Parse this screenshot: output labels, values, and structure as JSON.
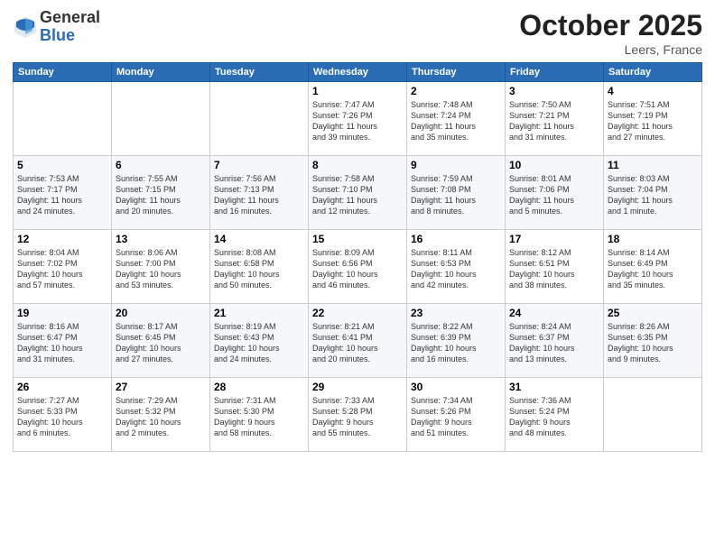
{
  "logo": {
    "general": "General",
    "blue": "Blue"
  },
  "header": {
    "month": "October 2025",
    "location": "Leers, France"
  },
  "weekdays": [
    "Sunday",
    "Monday",
    "Tuesday",
    "Wednesday",
    "Thursday",
    "Friday",
    "Saturday"
  ],
  "weeks": [
    [
      {
        "day": "",
        "info": ""
      },
      {
        "day": "",
        "info": ""
      },
      {
        "day": "",
        "info": ""
      },
      {
        "day": "1",
        "info": "Sunrise: 7:47 AM\nSunset: 7:26 PM\nDaylight: 11 hours\nand 39 minutes."
      },
      {
        "day": "2",
        "info": "Sunrise: 7:48 AM\nSunset: 7:24 PM\nDaylight: 11 hours\nand 35 minutes."
      },
      {
        "day": "3",
        "info": "Sunrise: 7:50 AM\nSunset: 7:21 PM\nDaylight: 11 hours\nand 31 minutes."
      },
      {
        "day": "4",
        "info": "Sunrise: 7:51 AM\nSunset: 7:19 PM\nDaylight: 11 hours\nand 27 minutes."
      }
    ],
    [
      {
        "day": "5",
        "info": "Sunrise: 7:53 AM\nSunset: 7:17 PM\nDaylight: 11 hours\nand 24 minutes."
      },
      {
        "day": "6",
        "info": "Sunrise: 7:55 AM\nSunset: 7:15 PM\nDaylight: 11 hours\nand 20 minutes."
      },
      {
        "day": "7",
        "info": "Sunrise: 7:56 AM\nSunset: 7:13 PM\nDaylight: 11 hours\nand 16 minutes."
      },
      {
        "day": "8",
        "info": "Sunrise: 7:58 AM\nSunset: 7:10 PM\nDaylight: 11 hours\nand 12 minutes."
      },
      {
        "day": "9",
        "info": "Sunrise: 7:59 AM\nSunset: 7:08 PM\nDaylight: 11 hours\nand 8 minutes."
      },
      {
        "day": "10",
        "info": "Sunrise: 8:01 AM\nSunset: 7:06 PM\nDaylight: 11 hours\nand 5 minutes."
      },
      {
        "day": "11",
        "info": "Sunrise: 8:03 AM\nSunset: 7:04 PM\nDaylight: 11 hours\nand 1 minute."
      }
    ],
    [
      {
        "day": "12",
        "info": "Sunrise: 8:04 AM\nSunset: 7:02 PM\nDaylight: 10 hours\nand 57 minutes."
      },
      {
        "day": "13",
        "info": "Sunrise: 8:06 AM\nSunset: 7:00 PM\nDaylight: 10 hours\nand 53 minutes."
      },
      {
        "day": "14",
        "info": "Sunrise: 8:08 AM\nSunset: 6:58 PM\nDaylight: 10 hours\nand 50 minutes."
      },
      {
        "day": "15",
        "info": "Sunrise: 8:09 AM\nSunset: 6:56 PM\nDaylight: 10 hours\nand 46 minutes."
      },
      {
        "day": "16",
        "info": "Sunrise: 8:11 AM\nSunset: 6:53 PM\nDaylight: 10 hours\nand 42 minutes."
      },
      {
        "day": "17",
        "info": "Sunrise: 8:12 AM\nSunset: 6:51 PM\nDaylight: 10 hours\nand 38 minutes."
      },
      {
        "day": "18",
        "info": "Sunrise: 8:14 AM\nSunset: 6:49 PM\nDaylight: 10 hours\nand 35 minutes."
      }
    ],
    [
      {
        "day": "19",
        "info": "Sunrise: 8:16 AM\nSunset: 6:47 PM\nDaylight: 10 hours\nand 31 minutes."
      },
      {
        "day": "20",
        "info": "Sunrise: 8:17 AM\nSunset: 6:45 PM\nDaylight: 10 hours\nand 27 minutes."
      },
      {
        "day": "21",
        "info": "Sunrise: 8:19 AM\nSunset: 6:43 PM\nDaylight: 10 hours\nand 24 minutes."
      },
      {
        "day": "22",
        "info": "Sunrise: 8:21 AM\nSunset: 6:41 PM\nDaylight: 10 hours\nand 20 minutes."
      },
      {
        "day": "23",
        "info": "Sunrise: 8:22 AM\nSunset: 6:39 PM\nDaylight: 10 hours\nand 16 minutes."
      },
      {
        "day": "24",
        "info": "Sunrise: 8:24 AM\nSunset: 6:37 PM\nDaylight: 10 hours\nand 13 minutes."
      },
      {
        "day": "25",
        "info": "Sunrise: 8:26 AM\nSunset: 6:35 PM\nDaylight: 10 hours\nand 9 minutes."
      }
    ],
    [
      {
        "day": "26",
        "info": "Sunrise: 7:27 AM\nSunset: 5:33 PM\nDaylight: 10 hours\nand 6 minutes."
      },
      {
        "day": "27",
        "info": "Sunrise: 7:29 AM\nSunset: 5:32 PM\nDaylight: 10 hours\nand 2 minutes."
      },
      {
        "day": "28",
        "info": "Sunrise: 7:31 AM\nSunset: 5:30 PM\nDaylight: 9 hours\nand 58 minutes."
      },
      {
        "day": "29",
        "info": "Sunrise: 7:33 AM\nSunset: 5:28 PM\nDaylight: 9 hours\nand 55 minutes."
      },
      {
        "day": "30",
        "info": "Sunrise: 7:34 AM\nSunset: 5:26 PM\nDaylight: 9 hours\nand 51 minutes."
      },
      {
        "day": "31",
        "info": "Sunrise: 7:36 AM\nSunset: 5:24 PM\nDaylight: 9 hours\nand 48 minutes."
      },
      {
        "day": "",
        "info": ""
      }
    ]
  ]
}
